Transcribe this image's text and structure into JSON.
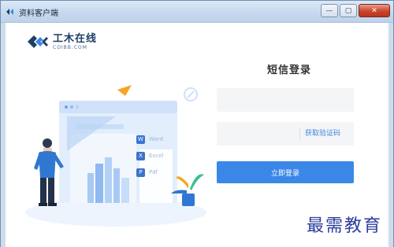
{
  "window": {
    "title": "资料客户端",
    "buttons": {
      "minimize": "—",
      "maximize": "▢",
      "close": "✕"
    }
  },
  "logo": {
    "cn": "工木在线",
    "en": "COIBB.COM"
  },
  "illustration": {
    "apps": [
      {
        "badge": "W",
        "label": "Word",
        "color": "#3b76d6"
      },
      {
        "badge": "X",
        "label": "Excel",
        "color": "#3e74c9"
      },
      {
        "badge": "P",
        "label": "Pdf",
        "color": "#3e74c9"
      }
    ]
  },
  "login": {
    "title": "短信登录",
    "phone_placeholder": "",
    "code_placeholder": "",
    "get_code": "获取验证码",
    "submit": "立即登录"
  },
  "watermark": "最需教育",
  "colors": {
    "accent": "#3b87e8",
    "link": "#3f86e5",
    "field_bg": "#f4f5f7"
  }
}
